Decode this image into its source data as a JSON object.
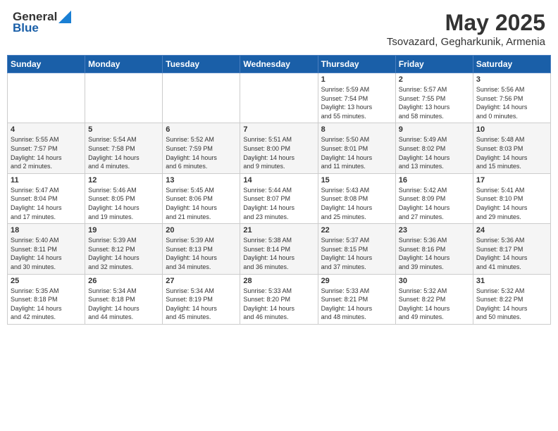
{
  "header": {
    "logo_general": "General",
    "logo_blue": "Blue",
    "title": "May 2025",
    "location": "Tsovazard, Gegharkunik, Armenia"
  },
  "days_of_week": [
    "Sunday",
    "Monday",
    "Tuesday",
    "Wednesday",
    "Thursday",
    "Friday",
    "Saturday"
  ],
  "weeks": [
    [
      {
        "day": "",
        "info": ""
      },
      {
        "day": "",
        "info": ""
      },
      {
        "day": "",
        "info": ""
      },
      {
        "day": "",
        "info": ""
      },
      {
        "day": "1",
        "info": "Sunrise: 5:59 AM\nSunset: 7:54 PM\nDaylight: 13 hours\nand 55 minutes."
      },
      {
        "day": "2",
        "info": "Sunrise: 5:57 AM\nSunset: 7:55 PM\nDaylight: 13 hours\nand 58 minutes."
      },
      {
        "day": "3",
        "info": "Sunrise: 5:56 AM\nSunset: 7:56 PM\nDaylight: 14 hours\nand 0 minutes."
      }
    ],
    [
      {
        "day": "4",
        "info": "Sunrise: 5:55 AM\nSunset: 7:57 PM\nDaylight: 14 hours\nand 2 minutes."
      },
      {
        "day": "5",
        "info": "Sunrise: 5:54 AM\nSunset: 7:58 PM\nDaylight: 14 hours\nand 4 minutes."
      },
      {
        "day": "6",
        "info": "Sunrise: 5:52 AM\nSunset: 7:59 PM\nDaylight: 14 hours\nand 6 minutes."
      },
      {
        "day": "7",
        "info": "Sunrise: 5:51 AM\nSunset: 8:00 PM\nDaylight: 14 hours\nand 9 minutes."
      },
      {
        "day": "8",
        "info": "Sunrise: 5:50 AM\nSunset: 8:01 PM\nDaylight: 14 hours\nand 11 minutes."
      },
      {
        "day": "9",
        "info": "Sunrise: 5:49 AM\nSunset: 8:02 PM\nDaylight: 14 hours\nand 13 minutes."
      },
      {
        "day": "10",
        "info": "Sunrise: 5:48 AM\nSunset: 8:03 PM\nDaylight: 14 hours\nand 15 minutes."
      }
    ],
    [
      {
        "day": "11",
        "info": "Sunrise: 5:47 AM\nSunset: 8:04 PM\nDaylight: 14 hours\nand 17 minutes."
      },
      {
        "day": "12",
        "info": "Sunrise: 5:46 AM\nSunset: 8:05 PM\nDaylight: 14 hours\nand 19 minutes."
      },
      {
        "day": "13",
        "info": "Sunrise: 5:45 AM\nSunset: 8:06 PM\nDaylight: 14 hours\nand 21 minutes."
      },
      {
        "day": "14",
        "info": "Sunrise: 5:44 AM\nSunset: 8:07 PM\nDaylight: 14 hours\nand 23 minutes."
      },
      {
        "day": "15",
        "info": "Sunrise: 5:43 AM\nSunset: 8:08 PM\nDaylight: 14 hours\nand 25 minutes."
      },
      {
        "day": "16",
        "info": "Sunrise: 5:42 AM\nSunset: 8:09 PM\nDaylight: 14 hours\nand 27 minutes."
      },
      {
        "day": "17",
        "info": "Sunrise: 5:41 AM\nSunset: 8:10 PM\nDaylight: 14 hours\nand 29 minutes."
      }
    ],
    [
      {
        "day": "18",
        "info": "Sunrise: 5:40 AM\nSunset: 8:11 PM\nDaylight: 14 hours\nand 30 minutes."
      },
      {
        "day": "19",
        "info": "Sunrise: 5:39 AM\nSunset: 8:12 PM\nDaylight: 14 hours\nand 32 minutes."
      },
      {
        "day": "20",
        "info": "Sunrise: 5:39 AM\nSunset: 8:13 PM\nDaylight: 14 hours\nand 34 minutes."
      },
      {
        "day": "21",
        "info": "Sunrise: 5:38 AM\nSunset: 8:14 PM\nDaylight: 14 hours\nand 36 minutes."
      },
      {
        "day": "22",
        "info": "Sunrise: 5:37 AM\nSunset: 8:15 PM\nDaylight: 14 hours\nand 37 minutes."
      },
      {
        "day": "23",
        "info": "Sunrise: 5:36 AM\nSunset: 8:16 PM\nDaylight: 14 hours\nand 39 minutes."
      },
      {
        "day": "24",
        "info": "Sunrise: 5:36 AM\nSunset: 8:17 PM\nDaylight: 14 hours\nand 41 minutes."
      }
    ],
    [
      {
        "day": "25",
        "info": "Sunrise: 5:35 AM\nSunset: 8:18 PM\nDaylight: 14 hours\nand 42 minutes."
      },
      {
        "day": "26",
        "info": "Sunrise: 5:34 AM\nSunset: 8:18 PM\nDaylight: 14 hours\nand 44 minutes."
      },
      {
        "day": "27",
        "info": "Sunrise: 5:34 AM\nSunset: 8:19 PM\nDaylight: 14 hours\nand 45 minutes."
      },
      {
        "day": "28",
        "info": "Sunrise: 5:33 AM\nSunset: 8:20 PM\nDaylight: 14 hours\nand 46 minutes."
      },
      {
        "day": "29",
        "info": "Sunrise: 5:33 AM\nSunset: 8:21 PM\nDaylight: 14 hours\nand 48 minutes."
      },
      {
        "day": "30",
        "info": "Sunrise: 5:32 AM\nSunset: 8:22 PM\nDaylight: 14 hours\nand 49 minutes."
      },
      {
        "day": "31",
        "info": "Sunrise: 5:32 AM\nSunset: 8:22 PM\nDaylight: 14 hours\nand 50 minutes."
      }
    ]
  ]
}
